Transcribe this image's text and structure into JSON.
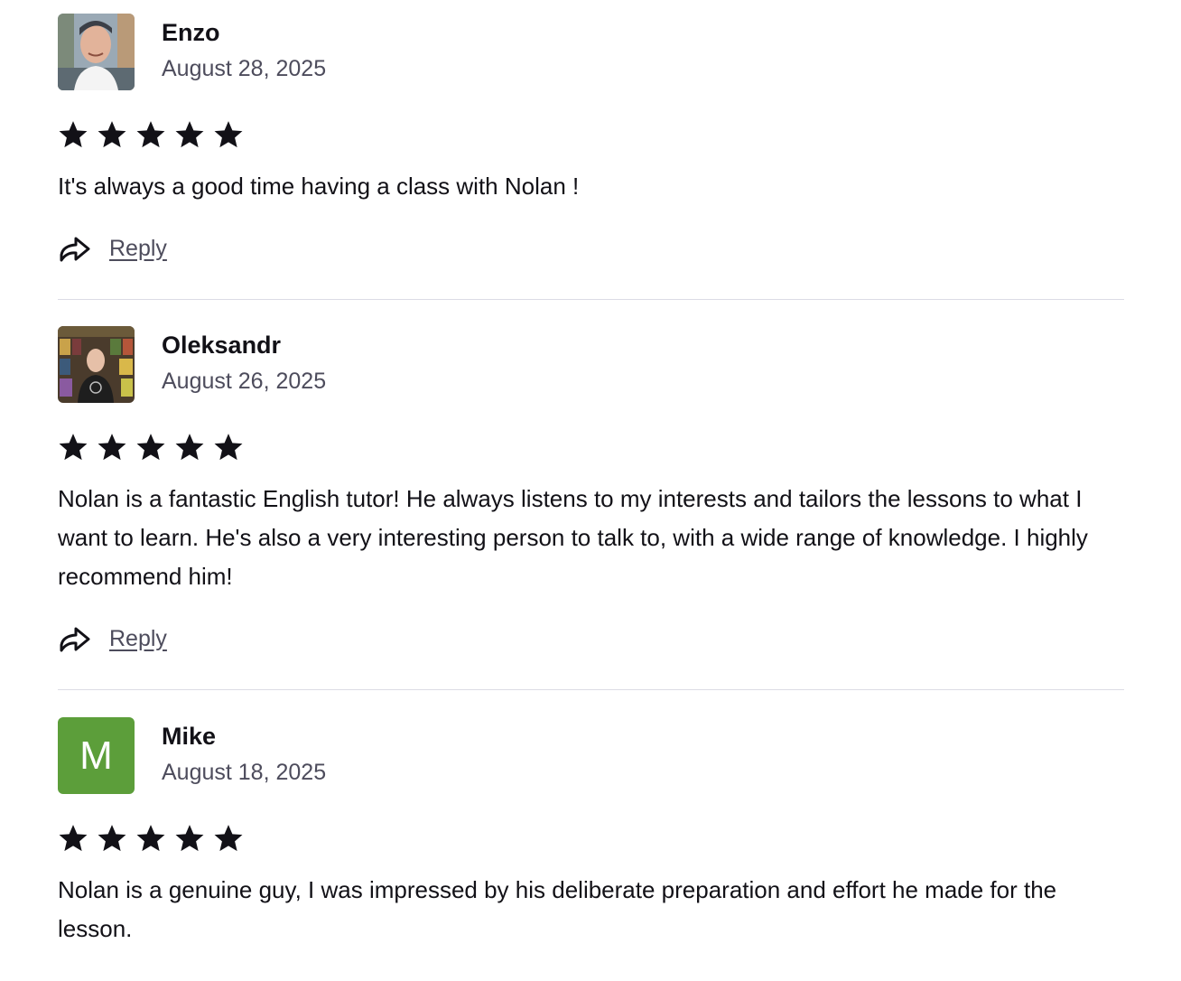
{
  "reviews": [
    {
      "name": "Enzo",
      "date": "August 28, 2025",
      "rating": 5,
      "text": "It's always a good time having a class with Nolan !",
      "reply_label": "Reply",
      "avatar": {
        "type": "photo"
      }
    },
    {
      "name": "Oleksandr",
      "date": "August 26, 2025",
      "rating": 5,
      "text": "Nolan is a fantastic English tutor! He always listens to my interests and tailors the lessons to what I want to learn. He's also a very interesting person to talk to, with a wide range of knowledge. I highly recommend him!",
      "reply_label": "Reply",
      "avatar": {
        "type": "photo"
      }
    },
    {
      "name": "Mike",
      "date": "August 18, 2025",
      "rating": 5,
      "text": "Nolan is a genuine guy, I was impressed by his deliberate preparation and effort he made for the lesson.",
      "avatar": {
        "type": "letter",
        "letter": "M",
        "color": "#5c9e3a"
      }
    }
  ],
  "colors": {
    "text": "#121117",
    "muted": "#4d4c5c",
    "divider": "#dcdce5",
    "star": "#121117"
  }
}
